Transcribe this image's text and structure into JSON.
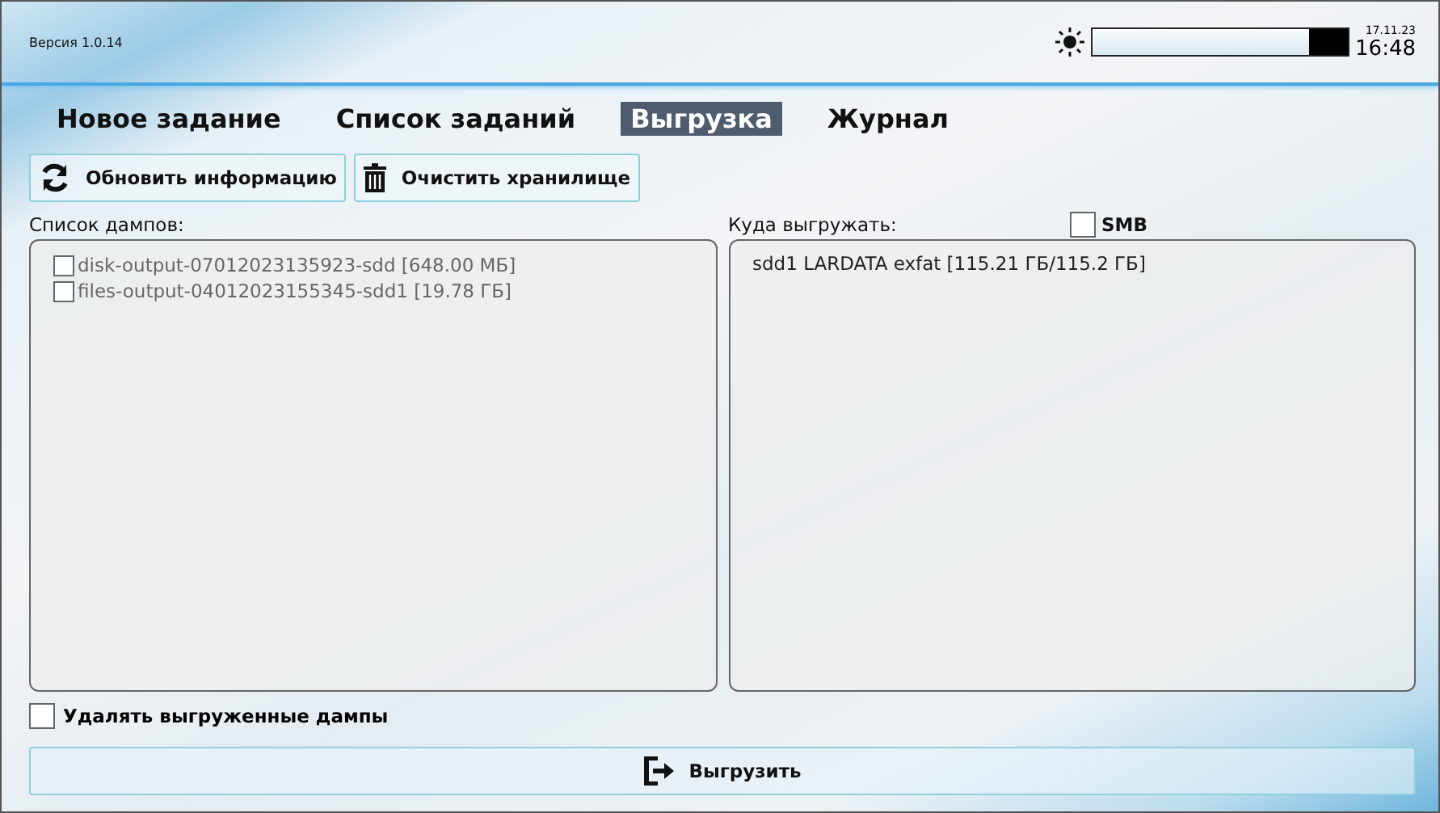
{
  "header": {
    "version": "Версия 1.0.14",
    "brightness": {
      "level": 0.85
    },
    "date": "17.11.23",
    "time": "16:48"
  },
  "tabs": [
    {
      "label": "Новое задание",
      "selected": false
    },
    {
      "label": "Список заданий",
      "selected": false
    },
    {
      "label": "Выгрузка",
      "selected": true
    },
    {
      "label": "Журнал",
      "selected": false
    }
  ],
  "toolbar": [
    {
      "label": "Обновить информацию",
      "kind": "refresh"
    },
    {
      "label": "Очистить хранилище",
      "kind": "trash"
    }
  ],
  "dumps": {
    "label": "Список дампов:",
    "items": [
      {
        "label": "disk-output-07012023135923-sdd [648.00 МБ]",
        "checked": false
      },
      {
        "label": "files-output-04012023155345-sdd1 [19.78 ГБ]",
        "checked": false
      }
    ]
  },
  "target": {
    "label": "Куда выгружать:",
    "smb": {
      "label": "SMB",
      "checked": false
    },
    "items": [
      "sdd1 LARDATA exfat [115.21 ГБ/115.2 ГБ]"
    ]
  },
  "delete_option": {
    "label": "Удалять выгруженные дампы",
    "checked": false
  },
  "export_button": {
    "label": "Выгрузить"
  }
}
